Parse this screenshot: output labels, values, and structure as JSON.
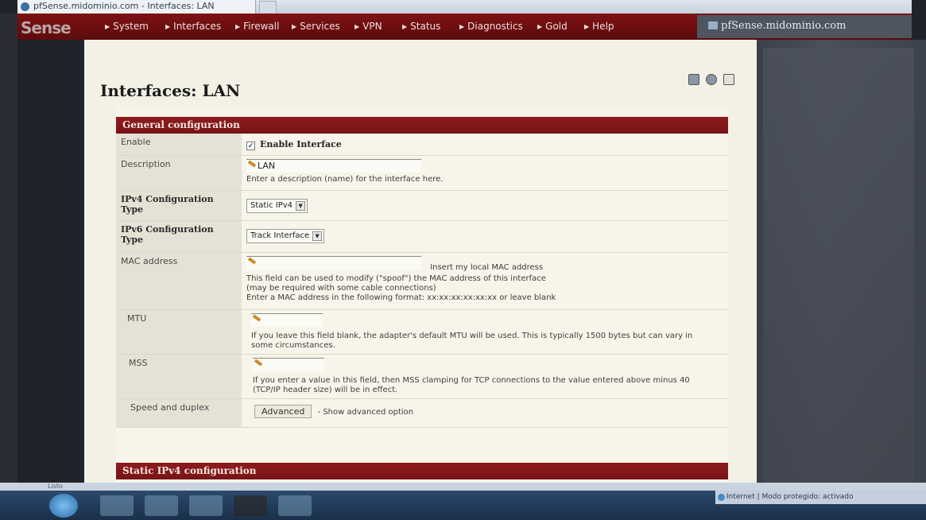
{
  "browser": {
    "tab_title": "pfSense.midominio.com - Interfaces: LAN"
  },
  "nav": {
    "logo": "Sense",
    "items": [
      "System",
      "Interfaces",
      "Firewall",
      "Services",
      "VPN",
      "Status",
      "Diagnostics",
      "Gold",
      "Help"
    ],
    "hostname": "pfSense.midominio.com"
  },
  "page": {
    "title": "Interfaces: LAN"
  },
  "sections": {
    "general": "General configuration",
    "static_ipv4": "Static IPv4 configuration"
  },
  "form": {
    "enable": {
      "label": "Enable",
      "checked": true,
      "checkbox_label": "Enable Interface"
    },
    "description": {
      "label": "Description",
      "value": "LAN",
      "help": "Enter a description (name) for the interface here."
    },
    "ipv4_type": {
      "label": "IPv4 Configuration Type",
      "selected": "Static IPv4"
    },
    "ipv6_type": {
      "label": "IPv6 Configuration Type",
      "selected": "Track Interface"
    },
    "mac": {
      "label": "MAC address",
      "value": "",
      "link": "Insert my local MAC address",
      "help1": "This field can be used to modify (\"spoof\") the MAC address of this interface",
      "help2": "(may be required with some cable connections)",
      "help3": "Enter a MAC address in the following format: xx:xx:xx:xx:xx:xx or leave blank"
    },
    "mtu": {
      "label": "MTU",
      "value": "",
      "help": "If you leave this field blank, the adapter's default MTU will be used. This is typically 1500 bytes but can vary in some circumstances."
    },
    "mss": {
      "label": "MSS",
      "value": "",
      "help": "If you enter a value in this field, then MSS clamping for TCP connections to the value entered above minus 40 (TCP/IP header size) will be in effect."
    },
    "speed": {
      "label": "Speed and duplex",
      "button": "Advanced",
      "note": "- Show advanced option"
    }
  },
  "statusbar": {
    "left": "Listo",
    "right": "Internet | Modo protegido: activado"
  },
  "colors": {
    "nav_red": "#6e0f11",
    "section_red": "#861a1c",
    "page_bg": "#f3f1e6"
  }
}
